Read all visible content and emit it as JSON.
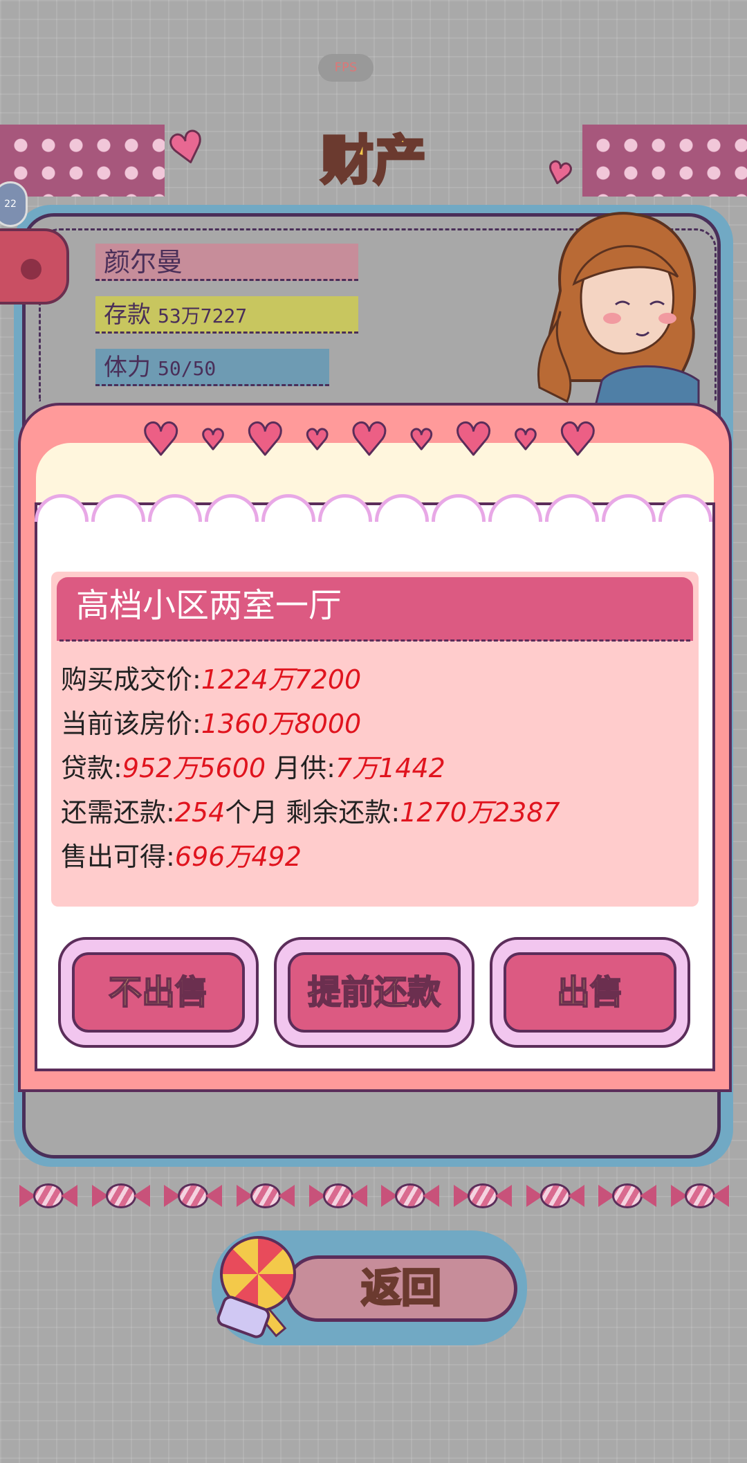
{
  "hud": {
    "fps_label": "FPS"
  },
  "header": {
    "title": "财产"
  },
  "profile": {
    "name": "颜尔曼",
    "savings_label": "存款",
    "savings_value": "53万7227",
    "stamina_label": "体力",
    "stamina_value": "50/50",
    "side_badge": "22"
  },
  "property": {
    "title": "高档小区两室一厅",
    "lines": [
      {
        "label": "购买成交价:",
        "value": "1224万7200"
      },
      {
        "label": "当前该房价:",
        "value": "1360万8000"
      },
      {
        "label": "贷款:",
        "value": "952万5600",
        "label2": " 月供:",
        "value2": "7万1442"
      },
      {
        "label": "还需还款:",
        "value": "254",
        "label2": "个月 剩余还款:",
        "value2": "1270万2387"
      },
      {
        "label": "售出可得:",
        "value": "696万492"
      }
    ]
  },
  "actions": {
    "not_sell": "不出售",
    "prepay": "提前还款",
    "sell": "出售"
  },
  "footer": {
    "back": "返回"
  },
  "icons": [
    "heart-icon",
    "candy-icon",
    "lollipop-icon",
    "character-portrait"
  ],
  "colors": {
    "accent_pink": "#dc5a82",
    "button_text_yellow": "#f6ee7a",
    "value_red": "#e0141e",
    "frame_pink": "#ff9a9a",
    "panel_pink": "#ffcccc"
  }
}
